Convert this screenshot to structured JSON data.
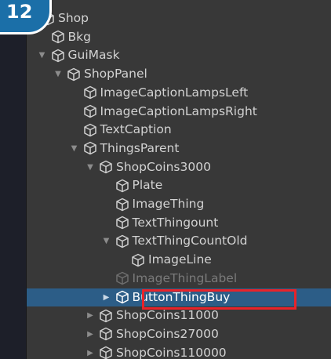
{
  "step_badge": "12",
  "hierarchy": [
    {
      "label": "Shop",
      "depth": 1,
      "expander": "none",
      "state": "normal"
    },
    {
      "label": "Bkg",
      "depth": 2,
      "expander": "none",
      "state": "normal"
    },
    {
      "label": "GuiMask",
      "depth": 2,
      "expander": "expanded",
      "state": "normal"
    },
    {
      "label": "ShopPanel",
      "depth": 3,
      "expander": "expanded",
      "state": "normal"
    },
    {
      "label": "ImageCaptionLampsLeft",
      "depth": 4,
      "expander": "none",
      "state": "normal"
    },
    {
      "label": "ImageCaptionLampsRight",
      "depth": 4,
      "expander": "none",
      "state": "normal"
    },
    {
      "label": "TextCaption",
      "depth": 4,
      "expander": "none",
      "state": "normal"
    },
    {
      "label": "ThingsParent",
      "depth": 4,
      "expander": "expanded",
      "state": "normal"
    },
    {
      "label": "ShopCoins3000",
      "depth": 5,
      "expander": "expanded",
      "state": "normal"
    },
    {
      "label": "Plate",
      "depth": 6,
      "expander": "none",
      "state": "normal"
    },
    {
      "label": "ImageThing",
      "depth": 6,
      "expander": "none",
      "state": "normal"
    },
    {
      "label": "TextThingount",
      "depth": 6,
      "expander": "none",
      "state": "normal"
    },
    {
      "label": "TextThingCountOld",
      "depth": 6,
      "expander": "expanded",
      "state": "normal"
    },
    {
      "label": "ImageLine",
      "depth": 7,
      "expander": "none",
      "state": "normal"
    },
    {
      "label": "ImageThingLabel",
      "depth": 6,
      "expander": "none",
      "state": "inactive"
    },
    {
      "label": "ButtonThingBuy",
      "depth": 6,
      "expander": "collapsed",
      "state": "selected"
    },
    {
      "label": "ShopCoins11000",
      "depth": 5,
      "expander": "collapsed",
      "state": "normal"
    },
    {
      "label": "ShopCoins27000",
      "depth": 5,
      "expander": "collapsed",
      "state": "normal"
    },
    {
      "label": "ShopCoins110000",
      "depth": 5,
      "expander": "collapsed",
      "state": "normal"
    }
  ],
  "colors": {
    "panel_bg": "#383838",
    "selected_bg": "#2c5d87",
    "highlight_border": "#e8232a",
    "badge_bg": "#1b6fa8"
  },
  "icons": {
    "object": "cube-icon",
    "expanded": "triangle-down-icon",
    "collapsed": "triangle-right-icon"
  }
}
